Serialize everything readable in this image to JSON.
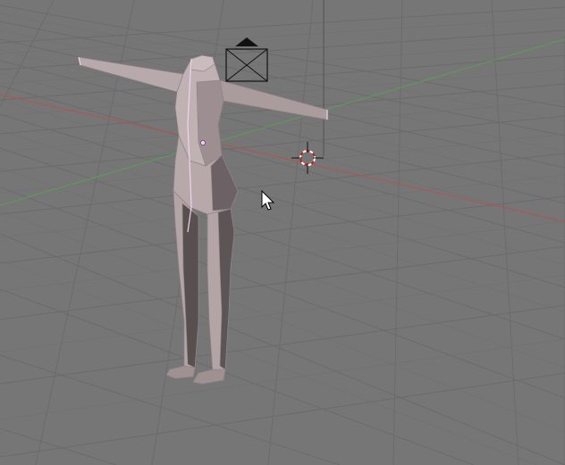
{
  "viewport": {
    "background_color": "#767676",
    "grid_color": "#6a6a6a",
    "x_axis_color": "#b25454",
    "y_axis_color": "#5d9b5d",
    "mesh_color": "#b3a4a6",
    "mesh_selected_edge_color": "#f2d3ef"
  },
  "scene": {
    "mesh": {
      "name": "character-mesh",
      "icon": "humanoid-mesh"
    },
    "camera": {
      "icon": "camera-icon"
    },
    "cursor_3d": {
      "icon": "3d-cursor-icon"
    },
    "pointer": {
      "icon": "mouse-pointer-icon"
    }
  }
}
